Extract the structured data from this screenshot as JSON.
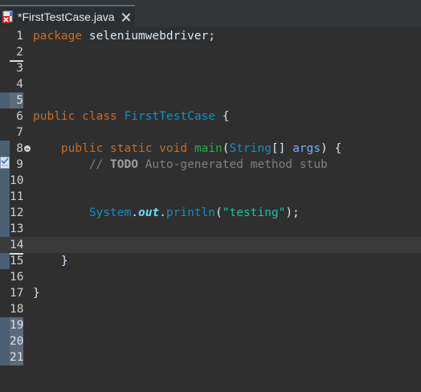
{
  "tab": {
    "title": "*FirstTestCase.java"
  },
  "editor": {
    "lines": [
      {
        "num": "1",
        "segments": [
          {
            "t": "package",
            "c": "kw"
          },
          {
            "t": " seleniumwebdriver;",
            "c": "plain"
          }
        ]
      },
      {
        "num": "2",
        "segments": []
      },
      {
        "num": "3",
        "segments": []
      },
      {
        "num": "4",
        "segments": []
      },
      {
        "num": "5",
        "segments": []
      },
      {
        "num": "6",
        "segments": [
          {
            "t": "public",
            "c": "kw"
          },
          {
            "t": " ",
            "c": "plain"
          },
          {
            "t": "class",
            "c": "kw"
          },
          {
            "t": " ",
            "c": "plain"
          },
          {
            "t": "FirstTestCase",
            "c": "cls"
          },
          {
            "t": " {",
            "c": "plain"
          }
        ]
      },
      {
        "num": "7",
        "segments": []
      },
      {
        "num": "8",
        "segments": [
          {
            "t": "    ",
            "c": "plain"
          },
          {
            "t": "public",
            "c": "kw"
          },
          {
            "t": " ",
            "c": "plain"
          },
          {
            "t": "static",
            "c": "kw"
          },
          {
            "t": " ",
            "c": "plain"
          },
          {
            "t": "void",
            "c": "kw"
          },
          {
            "t": " ",
            "c": "plain"
          },
          {
            "t": "main",
            "c": "fn"
          },
          {
            "t": "(",
            "c": "plain"
          },
          {
            "t": "String",
            "c": "cls"
          },
          {
            "t": "[] ",
            "c": "plain"
          },
          {
            "t": "args",
            "c": "param"
          },
          {
            "t": ") {",
            "c": "plain"
          }
        ]
      },
      {
        "num": "9",
        "segments": [
          {
            "t": "        ",
            "c": "plain"
          },
          {
            "t": "// ",
            "c": "cmt"
          },
          {
            "t": "TODO",
            "c": "todo"
          },
          {
            "t": " Auto-generated method stub",
            "c": "cmt"
          }
        ]
      },
      {
        "num": "10",
        "segments": []
      },
      {
        "num": "11",
        "segments": []
      },
      {
        "num": "12",
        "segments": [
          {
            "t": "        ",
            "c": "plain"
          },
          {
            "t": "System",
            "c": "cls"
          },
          {
            "t": ".",
            "c": "plain"
          },
          {
            "t": "out",
            "c": "field"
          },
          {
            "t": ".",
            "c": "plain"
          },
          {
            "t": "println",
            "c": "cls"
          },
          {
            "t": "(",
            "c": "plain"
          },
          {
            "t": "\"testing\"",
            "c": "str"
          },
          {
            "t": ");",
            "c": "plain"
          }
        ]
      },
      {
        "num": "13",
        "segments": []
      },
      {
        "num": "14",
        "segments": []
      },
      {
        "num": "15",
        "segments": [
          {
            "t": "    ",
            "c": "plain"
          },
          {
            "t": "}",
            "c": "plain"
          }
        ]
      },
      {
        "num": "16",
        "segments": []
      },
      {
        "num": "17",
        "segments": [
          {
            "t": "}",
            "c": "plain"
          }
        ]
      },
      {
        "num": "18",
        "segments": []
      },
      {
        "num": "19",
        "segments": []
      },
      {
        "num": "20",
        "segments": []
      },
      {
        "num": "21",
        "segments": []
      }
    ]
  },
  "colors": {
    "background": "#2f2f2f",
    "keyword": "#cc6c1d",
    "class": "#1290c3",
    "method": "#1eb540",
    "string": "#17c6a3",
    "comment": "#808080"
  }
}
